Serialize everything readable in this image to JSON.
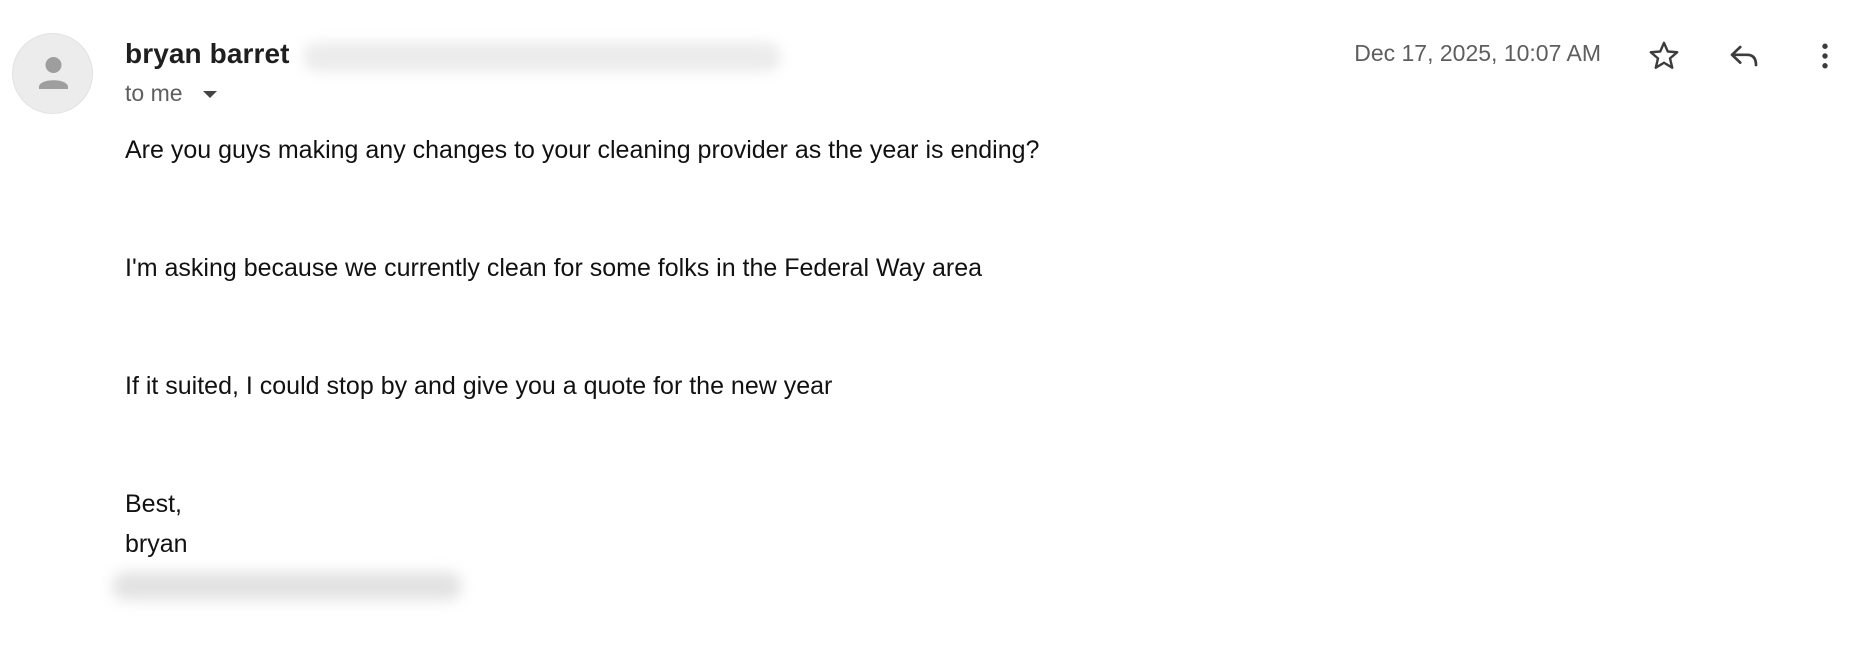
{
  "sender": {
    "name": "bryan barret"
  },
  "recipient": {
    "label": "to me"
  },
  "date": "Dec 17, 2025, 10:07 AM",
  "actions": {
    "star": "star-icon",
    "reply": "reply-icon",
    "more": "more-vert-icon"
  },
  "body": {
    "lines": [
      "Are you guys making any changes to your cleaning provider as the year is ending?",
      "I'm asking because we currently clean for some folks in the Federal Way area",
      "If it suited, I could stop by and give you a quote for the new year",
      "Best,",
      "bryan"
    ]
  },
  "colors": {
    "text": "#1f1f1f",
    "secondary": "#5e5e5e",
    "avatar_bg": "#ececec"
  }
}
